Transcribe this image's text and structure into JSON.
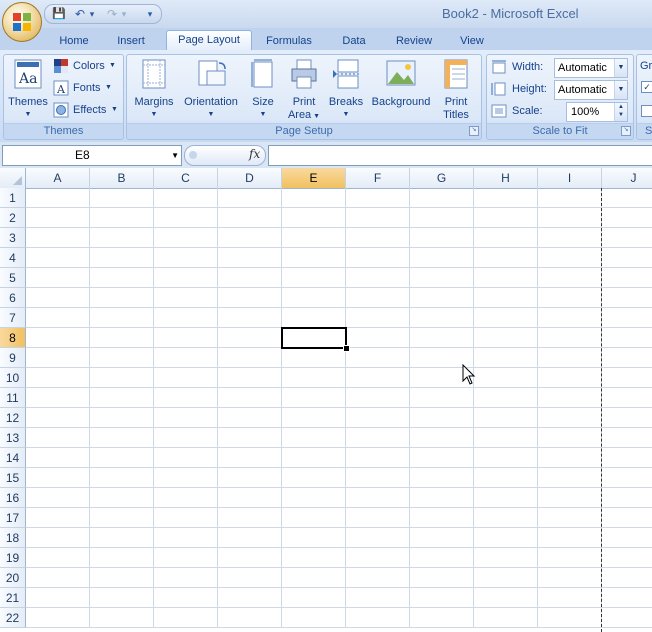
{
  "window": {
    "title_doc": "Book2",
    "title_sep": " - ",
    "title_app": "Microsoft Excel"
  },
  "qat": {
    "items": [
      {
        "name": "save-icon",
        "glyph": "💾"
      },
      {
        "name": "undo-icon",
        "glyph": "↶"
      },
      {
        "name": "undo-dropdown-icon",
        "glyph": "▾"
      },
      {
        "name": "redo-icon",
        "glyph": "↷"
      },
      {
        "name": "redo-dropdown-icon",
        "glyph": "▾"
      },
      {
        "name": "customize-qat-icon",
        "glyph": "▾"
      }
    ]
  },
  "tabs": [
    "Home",
    "Insert",
    "Page Layout",
    "Formulas",
    "Data",
    "Review",
    "View"
  ],
  "active_tab": "Page Layout",
  "ribbon": {
    "themes_group": {
      "label": "Themes",
      "themes_btn": "Themes",
      "colors": "Colors",
      "fonts": "Fonts",
      "effects": "Effects"
    },
    "page_setup_group": {
      "label": "Page Setup",
      "margins": "Margins",
      "orientation": "Orientation",
      "size": "Size",
      "print_area_1": "Print",
      "print_area_2": "Area",
      "breaks": "Breaks",
      "background": "Background",
      "print_titles_1": "Print",
      "print_titles_2": "Titles"
    },
    "scale_group": {
      "label": "Scale to Fit",
      "width_label": "Width:",
      "width_value": "Automatic",
      "height_label": "Height:",
      "height_value": "Automatic",
      "scale_label": "Scale:",
      "scale_value": "100%"
    },
    "sheet_options_group": {
      "label_partial": "Gr",
      "bottom_partial": "S"
    }
  },
  "formula_bar": {
    "name_box": "E8",
    "fx": "fx",
    "formula": ""
  },
  "sheet": {
    "columns": [
      "A",
      "B",
      "C",
      "D",
      "E",
      "F",
      "G",
      "H",
      "I",
      "J"
    ],
    "rows": [
      "1",
      "2",
      "3",
      "4",
      "5",
      "6",
      "7",
      "8",
      "9",
      "10",
      "11",
      "12",
      "13",
      "14",
      "15",
      "16",
      "17",
      "18",
      "19",
      "20",
      "21",
      "22"
    ],
    "selected_column": "E",
    "selected_row": "8",
    "colors": {
      "header_selected": "#f1c15f",
      "gridline": "#d0d7e5"
    }
  }
}
